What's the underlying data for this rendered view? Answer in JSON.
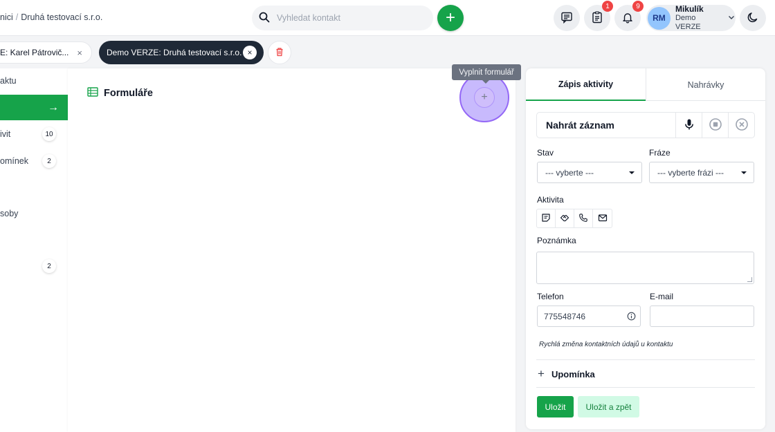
{
  "header": {
    "breadcrumb": [
      "nici",
      "Druhá testovací s.r.o."
    ],
    "search_placeholder": "Vyhledat kontakt",
    "add_symbol": "+",
    "notes_badge": "1",
    "notifications_badge": "9",
    "user": {
      "initials": "RM",
      "name": "Mikulík",
      "company": "Demo VERZE"
    }
  },
  "tabs": [
    {
      "label": "E: Karel Pátrovič...",
      "close": "×"
    },
    {
      "label": "Demo VERZE: Druhá testovací s.r.o.",
      "close": "×"
    }
  ],
  "left_menu": {
    "items": [
      {
        "label": "aktu",
        "count": ""
      },
      {
        "label": "ivit",
        "count": "10"
      },
      {
        "label": "omínek",
        "count": "2"
      },
      {
        "label": "soby",
        "count": ""
      },
      {
        "label": "",
        "count": "2"
      }
    ],
    "active_arrow": "→"
  },
  "main": {
    "title": "Formuláře",
    "tooltip": "Vyplnit formulář",
    "fill_symbol": "+"
  },
  "panel": {
    "tabs": [
      "Zápis aktivity",
      "Nahrávky"
    ],
    "record_label": "Nahrát záznam",
    "stav_label": "Stav",
    "stav_value": "--- vyberte ---",
    "fraze_label": "Fráze",
    "fraze_value": "--- vyberte frázi ---",
    "aktivita_label": "Aktivita",
    "poznamka_label": "Poznámka",
    "telefon_label": "Telefon",
    "telefon_value": "775548746",
    "email_label": "E-mail",
    "email_value": "",
    "hint": "Rychlá změna kontaktních údajů u kontaktu",
    "reminder_plus": "+",
    "reminder_label": "Upomínka",
    "save_label": "Uložit",
    "save_back_label": "Uložit a zpět"
  },
  "colors": {
    "accent": "#16a34a",
    "badge": "#ef4444",
    "highlight": "#8b5cf6"
  }
}
